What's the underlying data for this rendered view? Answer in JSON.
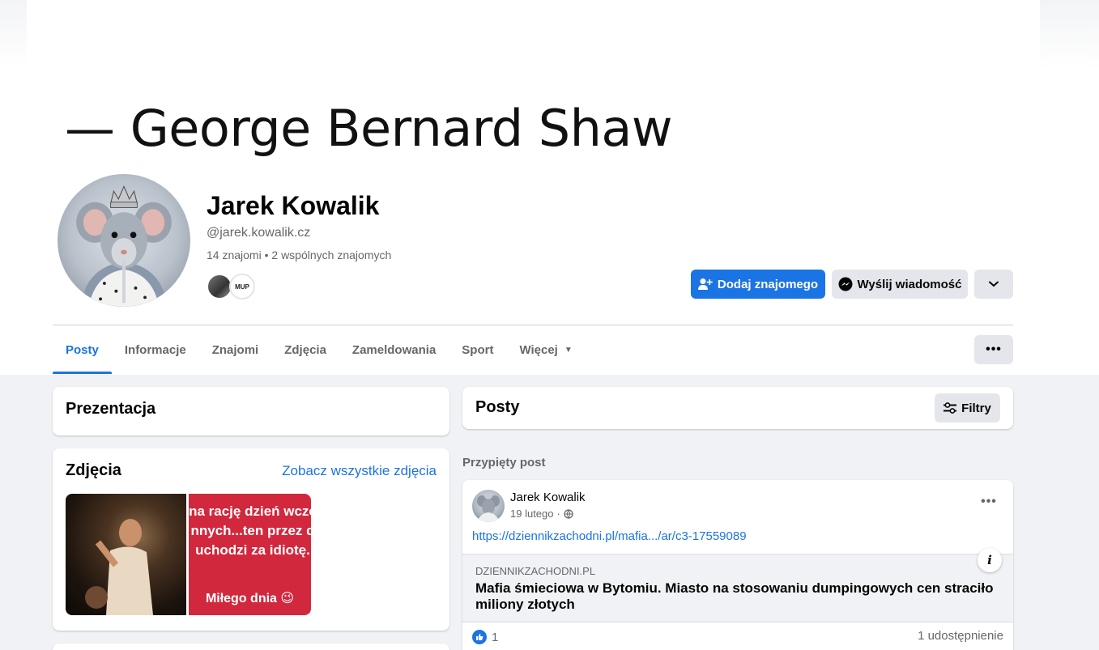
{
  "cover": {
    "quote_attribution": "— George Bernard Shaw"
  },
  "profile": {
    "name": "Jarek Kowalik",
    "handle": "@jarek.kowalik.cz",
    "friends": "14 znajomi",
    "separator": " • ",
    "mutual": "2 wspólnych znajomych",
    "mutual_avatar_2_text": "MUP"
  },
  "actions": {
    "add_friend": "Dodaj znajomego",
    "send_message": "Wyślij wiadomość"
  },
  "tabs": [
    {
      "label": "Posty",
      "active": true
    },
    {
      "label": "Informacje"
    },
    {
      "label": "Znajomi"
    },
    {
      "label": "Zdjęcia"
    },
    {
      "label": "Zameldowania"
    },
    {
      "label": "Sport"
    },
    {
      "label": "Więcej"
    }
  ],
  "intro": {
    "title": "Prezentacja"
  },
  "photos": {
    "title": "Zdjęcia",
    "see_all": "Zobacz wszystkie zdjęcia",
    "photo_2_lines": "na rację dzień wcze\nnnych...ten przez d\nuchodzi za idiotę.",
    "photo_2_footer": "Miłego dnia 😉"
  },
  "posts": {
    "title": "Posty",
    "filters": "Filtry",
    "pinned_label": "Przypięty post",
    "pinned": {
      "author": "Jarek Kowalik",
      "date": "19 lutego",
      "dot": "·",
      "link": "https://dziennikzachodni.pl/mafia.../ar/c3-17559089",
      "preview_domain": "DZIENNIKZACHODNI.PL",
      "preview_title": "Mafia śmieciowa w Bytomiu. Miasto na stosowaniu dumpingowych cen straciło miliony złotych",
      "likes": "1",
      "shares": "1 udostępnienie"
    }
  },
  "colors": {
    "accent": "#1b74e4",
    "page_bg": "#f0f2f5",
    "secondary_button": "#e4e6eb",
    "muted_text": "#65676b"
  }
}
